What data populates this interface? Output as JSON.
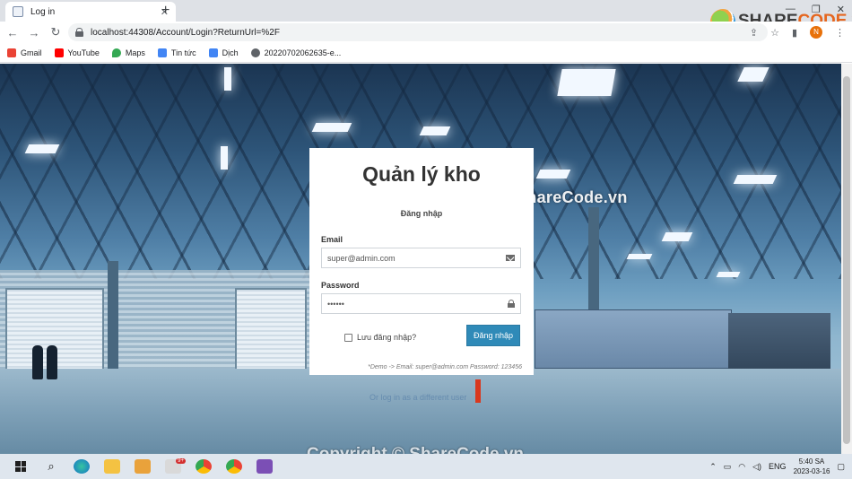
{
  "browser": {
    "tab_title": "Log in",
    "tab_close": "✕",
    "new_tab": "+",
    "url": "localhost:44308/Account/Login?ReturnUrl=%2F",
    "profile_initial": "N",
    "window_controls": {
      "min": "—",
      "max": "❐",
      "close": "✕"
    },
    "bookmarks": [
      {
        "label": "Gmail",
        "icon": "gmail-icon",
        "color": "#ea4335"
      },
      {
        "label": "YouTube",
        "icon": "youtube-icon",
        "color": "#ff0000"
      },
      {
        "label": "Maps",
        "icon": "maps-icon",
        "color": "#34a853"
      },
      {
        "label": "Tin tức",
        "icon": "news-icon",
        "color": "#4285f4"
      },
      {
        "label": "Dịch",
        "icon": "translate-icon",
        "color": "#4285f4"
      },
      {
        "label": "20220702062635-e...",
        "icon": "globe-icon",
        "color": "#5f6368"
      }
    ]
  },
  "watermark": {
    "logo_share": "SHARE",
    "logo_code": "CODE.vn",
    "center": "ShareCode.vn",
    "bottom": "Copyright © ShareCode.vn"
  },
  "login": {
    "title": "Quản lý kho",
    "subtitle": "Đăng nhập",
    "email_label": "Email",
    "email_value": "super@admin.com",
    "password_label": "Password",
    "password_value": "••••••",
    "remember_label": "Lưu đăng nhập?",
    "submit_label": "Đăng nhập",
    "demo_note": "*Demo -> Email: super@admin.com Password: 123456",
    "ghost_link": "Or log in as a different user"
  },
  "taskbar": {
    "language": "ENG",
    "time": "5:40 SA",
    "date": "2023-03-16",
    "badge": "9+"
  },
  "colors": {
    "accent": "#2f8ab8",
    "chrome_bg": "#dee1e6",
    "taskbar_bg": "#dfe6ee"
  }
}
